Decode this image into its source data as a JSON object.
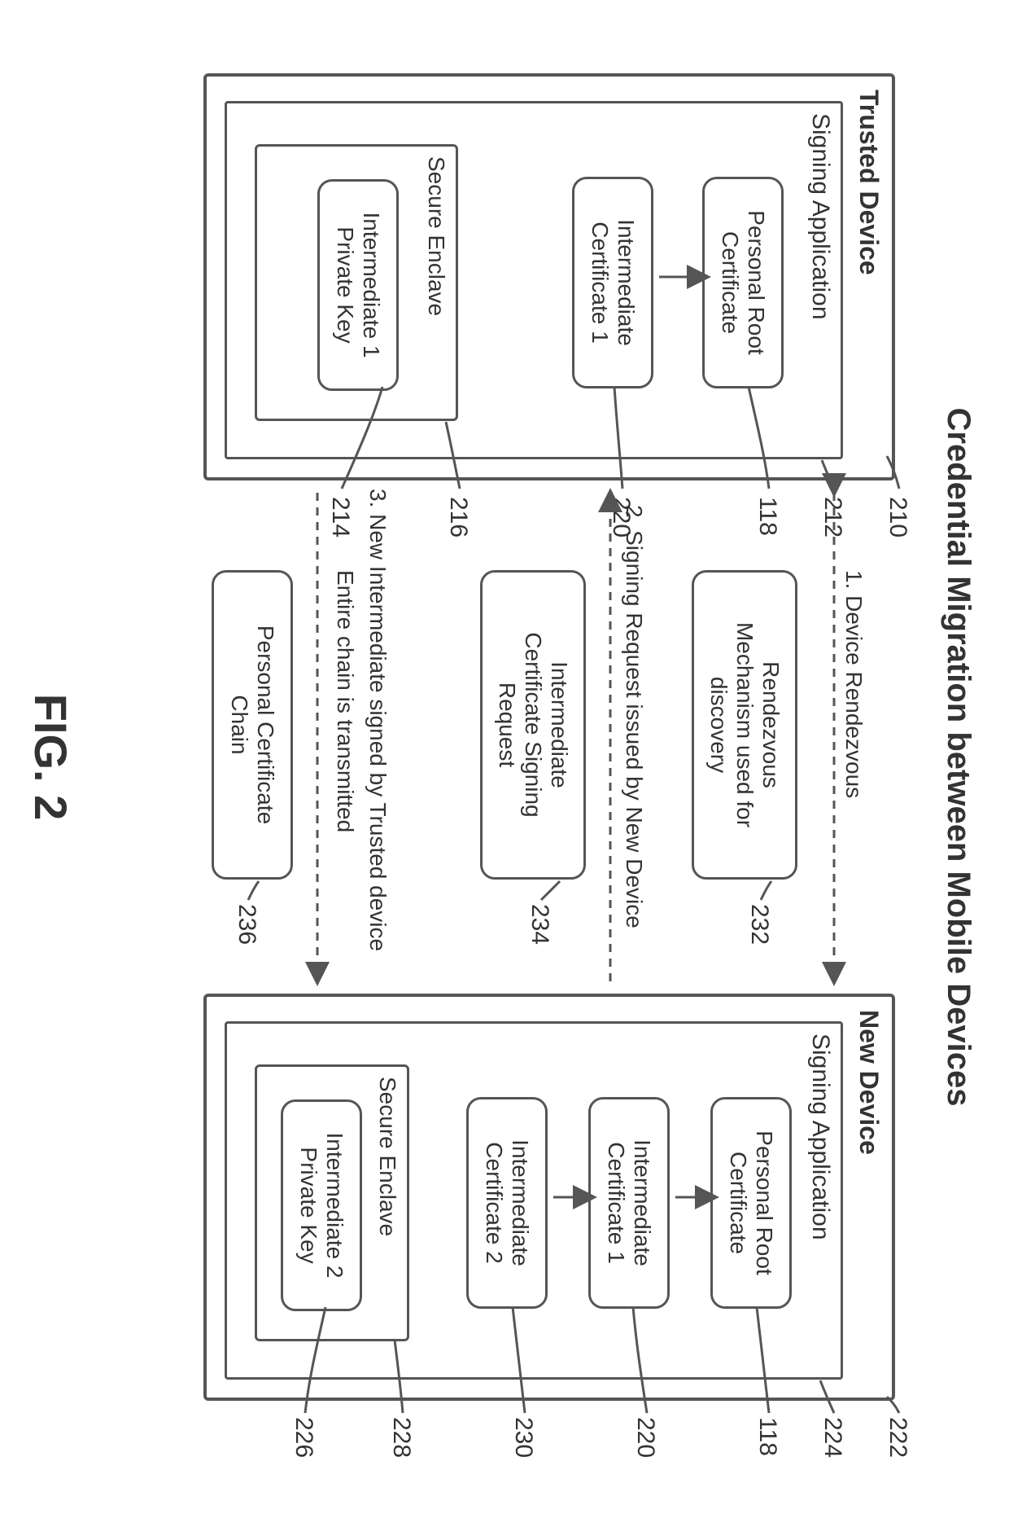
{
  "title": "Credential Migration between Mobile Devices",
  "figure_label": "FIG. 2",
  "trusted_device": {
    "title": "Trusted Device",
    "app": "Signing Application",
    "root": "Personal Root\nCertificate",
    "int1": "Intermediate\nCertificate 1",
    "enclave": "Secure Enclave",
    "key": "Intermediate 1\nPrivate Key"
  },
  "new_device": {
    "title": "New Device",
    "app": "Signing Application",
    "root": "Personal Root\nCertificate",
    "int1": "Intermediate\nCertificate 1",
    "int2": "Intermediate\nCertificate 2",
    "enclave": "Secure Enclave",
    "key": "Intermediate 2\nPrivate Key"
  },
  "middle": {
    "rendezvous": "Rendezvous\nMechanism used for\ndiscovery",
    "csr": "Intermediate\nCertificate Signing\nRequest",
    "chain": "Personal Certificate\nChain"
  },
  "steps": {
    "s1": "1. Device Rendezvous",
    "s2": "2. Signing Request issued by New Device",
    "s3a": "3. New Intermediate signed by Trusted device",
    "s3b": "Entire chain is transmitted"
  },
  "callouts": {
    "c210": "210",
    "c212": "212",
    "c118a": "118",
    "c220a": "220",
    "c216": "216",
    "c214": "214",
    "c222": "222",
    "c224": "224",
    "c118b": "118",
    "c220b": "220",
    "c230": "230",
    "c228": "228",
    "c226": "226",
    "c232": "232",
    "c234": "234",
    "c236": "236"
  }
}
